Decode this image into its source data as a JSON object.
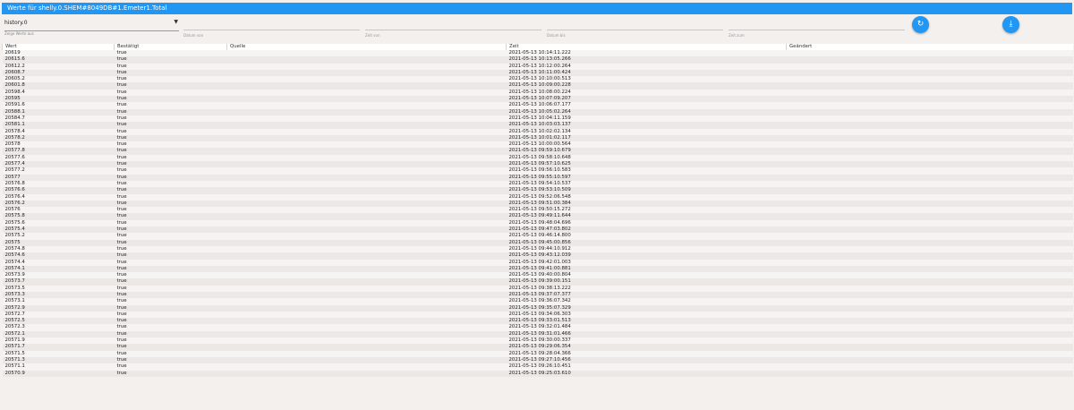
{
  "header": {
    "title": "Werte für shelly.0.SHEM#8049DB#1.Emeter1.Total"
  },
  "controls": {
    "instance_value": "history.0",
    "instance_helper": "Zeige Werte aus",
    "date_from": "Datum von",
    "time_from": "Zeit von",
    "date_to": "Datum bis",
    "time_to": "Zeit zum",
    "refresh_icon": "refresh-icon",
    "download_icon": "download-icon",
    "accent": "#2196f3"
  },
  "table": {
    "columns": [
      "Wert",
      "Bestätigt",
      "Quelle",
      "Zeit",
      "Geändert"
    ],
    "rows": [
      [
        "20619",
        "true",
        "",
        "2021-05-13 10:14:11.222",
        ""
      ],
      [
        "20615.6",
        "true",
        "",
        "2021-05-13 10:13:05.266",
        ""
      ],
      [
        "20612.2",
        "true",
        "",
        "2021-05-13 10:12:00.264",
        ""
      ],
      [
        "20608.7",
        "true",
        "",
        "2021-05-13 10:11:00.424",
        ""
      ],
      [
        "20605.2",
        "true",
        "",
        "2021-05-13 10:10:00.513",
        ""
      ],
      [
        "20601.8",
        "true",
        "",
        "2021-05-13 10:09:00.228",
        ""
      ],
      [
        "20598.4",
        "true",
        "",
        "2021-05-13 10:08:00.224",
        ""
      ],
      [
        "20595",
        "true",
        "",
        "2021-05-13 10:07:09.207",
        ""
      ],
      [
        "20591.6",
        "true",
        "",
        "2021-05-13 10:06:07.177",
        ""
      ],
      [
        "20588.1",
        "true",
        "",
        "2021-05-13 10:05:02.264",
        ""
      ],
      [
        "20584.7",
        "true",
        "",
        "2021-05-13 10:04:11.159",
        ""
      ],
      [
        "20581.1",
        "true",
        "",
        "2021-05-13 10:03:03.137",
        ""
      ],
      [
        "20578.4",
        "true",
        "",
        "2021-05-13 10:02:02.134",
        ""
      ],
      [
        "20578.2",
        "true",
        "",
        "2021-05-13 10:01:02.117",
        ""
      ],
      [
        "20578",
        "true",
        "",
        "2021-05-13 10:00:00.564",
        ""
      ],
      [
        "20577.8",
        "true",
        "",
        "2021-05-13 09:59:10.679",
        ""
      ],
      [
        "20577.6",
        "true",
        "",
        "2021-05-13 09:58:10.648",
        ""
      ],
      [
        "20577.4",
        "true",
        "",
        "2021-05-13 09:57:10.625",
        ""
      ],
      [
        "20577.2",
        "true",
        "",
        "2021-05-13 09:56:10.583",
        ""
      ],
      [
        "20577",
        "true",
        "",
        "2021-05-13 09:55:10.597",
        ""
      ],
      [
        "20576.8",
        "true",
        "",
        "2021-05-13 09:54:10.537",
        ""
      ],
      [
        "20576.6",
        "true",
        "",
        "2021-05-13 09:53:10.509",
        ""
      ],
      [
        "20576.4",
        "true",
        "",
        "2021-05-13 09:52:06.548",
        ""
      ],
      [
        "20576.2",
        "true",
        "",
        "2021-05-13 09:51:00.384",
        ""
      ],
      [
        "20576",
        "true",
        "",
        "2021-05-13 09:50:15.272",
        ""
      ],
      [
        "20575.8",
        "true",
        "",
        "2021-05-13 09:49:11.644",
        ""
      ],
      [
        "20575.6",
        "true",
        "",
        "2021-05-13 09:48:04.696",
        ""
      ],
      [
        "20575.4",
        "true",
        "",
        "2021-05-13 09:47:03.802",
        ""
      ],
      [
        "20575.2",
        "true",
        "",
        "2021-05-13 09:46:14.800",
        ""
      ],
      [
        "20575",
        "true",
        "",
        "2021-05-13 09:45:00.856",
        ""
      ],
      [
        "20574.8",
        "true",
        "",
        "2021-05-13 09:44:10.912",
        ""
      ],
      [
        "20574.6",
        "true",
        "",
        "2021-05-13 09:43:12.039",
        ""
      ],
      [
        "20574.4",
        "true",
        "",
        "2021-05-13 09:42:01.003",
        ""
      ],
      [
        "20574.1",
        "true",
        "",
        "2021-05-13 09:41:00.881",
        ""
      ],
      [
        "20573.9",
        "true",
        "",
        "2021-05-13 09:40:00.804",
        ""
      ],
      [
        "20573.7",
        "true",
        "",
        "2021-05-13 09:39:00.151",
        ""
      ],
      [
        "20573.5",
        "true",
        "",
        "2021-05-13 09:38:13.222",
        ""
      ],
      [
        "20573.3",
        "true",
        "",
        "2021-05-13 09:37:07.377",
        ""
      ],
      [
        "20573.1",
        "true",
        "",
        "2021-05-13 09:36:07.342",
        ""
      ],
      [
        "20572.9",
        "true",
        "",
        "2021-05-13 09:35:07.329",
        ""
      ],
      [
        "20572.7",
        "true",
        "",
        "2021-05-13 09:34:06.303",
        ""
      ],
      [
        "20572.5",
        "true",
        "",
        "2021-05-13 09:33:01.513",
        ""
      ],
      [
        "20572.3",
        "true",
        "",
        "2021-05-13 09:32:01.484",
        ""
      ],
      [
        "20572.1",
        "true",
        "",
        "2021-05-13 09:31:01.466",
        ""
      ],
      [
        "20571.9",
        "true",
        "",
        "2021-05-13 09:30:00.337",
        ""
      ],
      [
        "20571.7",
        "true",
        "",
        "2021-05-13 09:29:06.354",
        ""
      ],
      [
        "20571.5",
        "true",
        "",
        "2021-05-13 09:28:04.366",
        ""
      ],
      [
        "20571.3",
        "true",
        "",
        "2021-05-13 09:27:10.456",
        ""
      ],
      [
        "20571.1",
        "true",
        "",
        "2021-05-13 09:26:10.451",
        ""
      ],
      [
        "20570.9",
        "true",
        "",
        "2021-05-13 09:25:03.610",
        ""
      ]
    ]
  }
}
